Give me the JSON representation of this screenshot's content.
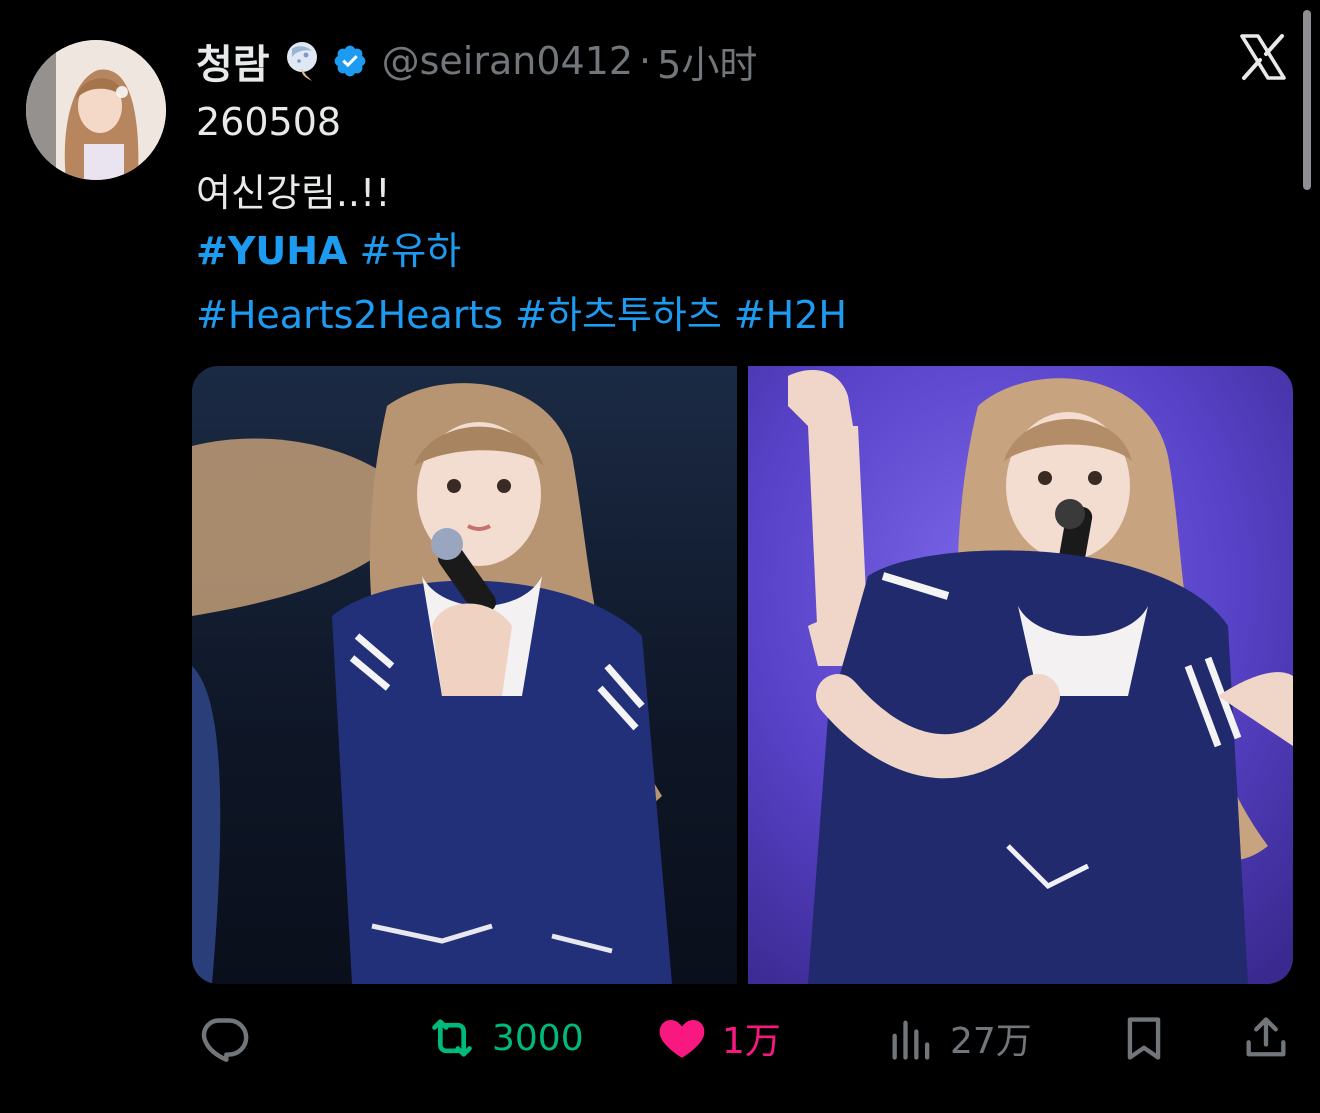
{
  "tweet": {
    "display_name": "청람",
    "handle": "@seiran0412",
    "separator": "·",
    "timestamp": "5小时",
    "text_lines": [
      "260508",
      "여신강림..!!"
    ],
    "hashtags_line1": [
      "#YUHA",
      "#유하"
    ],
    "hashtags_line2": [
      "#Hearts2Hearts",
      "#하츠투하츠",
      "#H2H"
    ]
  },
  "actions": {
    "reply_count": "",
    "retweet_count": "3000",
    "like_count": "1万",
    "views_count": "27万"
  },
  "icons": {
    "avatar": "profile-avatar",
    "emoji": "moon-rabbit-emoji-icon",
    "verified": "verified-badge-icon",
    "logo": "x-logo-icon",
    "reply": "reply-icon",
    "retweet": "retweet-icon",
    "like": "heart-icon",
    "views": "views-chart-icon",
    "bookmark": "bookmark-icon",
    "share": "share-icon"
  },
  "colors": {
    "background": "#000000",
    "text": "#e7e9ea",
    "muted": "#71767b",
    "link": "#1d9bf0",
    "retweet": "#00ba7c",
    "like": "#f91880",
    "verified": "#1d9bf0"
  }
}
